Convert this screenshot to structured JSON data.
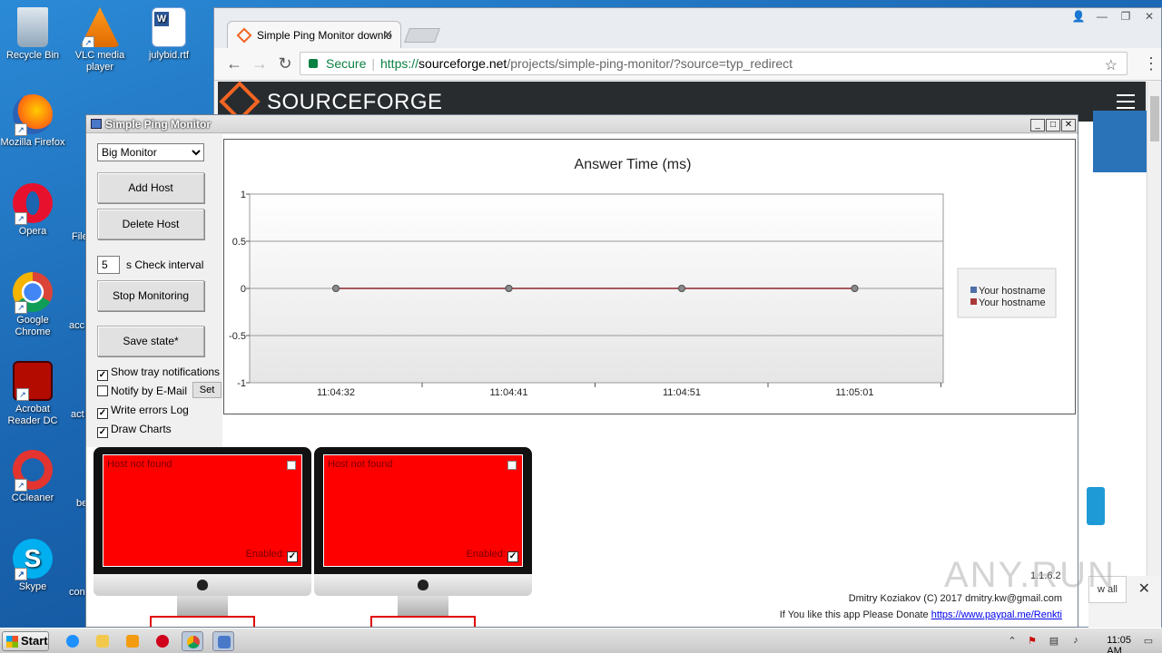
{
  "desktop": {
    "icons": [
      {
        "label": "Recycle Bin",
        "icon": "recycle-bin-icon"
      },
      {
        "label": "VLC media player",
        "icon": "vlc-icon"
      },
      {
        "label": "julybid.rtf",
        "icon": "word-document-icon"
      },
      {
        "label": "Mozilla Firefox",
        "icon": "firefox-icon"
      },
      {
        "label": "Opera",
        "icon": "opera-icon"
      },
      {
        "label": "Google Chrome",
        "icon": "chrome-icon"
      },
      {
        "label": "Acrobat Reader DC",
        "icon": "acrobat-icon"
      },
      {
        "label": "CCleaner",
        "icon": "ccleaner-icon"
      },
      {
        "label": "Skype",
        "icon": "skype-icon"
      }
    ],
    "partial_labels": [
      "File",
      "acc",
      "act",
      "be",
      "con"
    ]
  },
  "browser": {
    "tab_title": "Simple Ping Monitor downlo",
    "secure_label": "Secure",
    "url_scheme": "https://",
    "url_host": "sourceforge.net",
    "url_path": "/projects/simple-ping-monitor/?source=typ_redirect",
    "site_name": "SOURCEFORGE",
    "download_bar_button": "w all"
  },
  "ping_monitor": {
    "window_title": "Simple Ping Monitor",
    "mode_options": [
      "Big Monitor"
    ],
    "mode_selected": "Big Monitor",
    "add_host_label": "Add Host",
    "delete_host_label": "Delete Host",
    "interval_value": "5",
    "interval_label": "s Check interval",
    "stop_monitoring_label": "Stop Monitoring",
    "save_state_label": "Save state*",
    "checkboxes": [
      {
        "label": "Show tray notifications",
        "checked": true
      },
      {
        "label": "Notify by E-Mail",
        "checked": false
      },
      {
        "label": "Write errors Log",
        "checked": true
      },
      {
        "label": "Draw Charts",
        "checked": true
      }
    ],
    "set_button_label": "Set",
    "monitors": [
      {
        "status": "Host not found",
        "enabled_label": "Enabled:",
        "enabled": true,
        "color": "#ff0000"
      },
      {
        "status": "Host not found",
        "enabled_label": "Enabled:",
        "enabled": true,
        "color": "#ff0000"
      }
    ],
    "version": "1.1.6.2",
    "author": "Dmitry Koziakov (C) 2017 dmitry.kw@gmail.com",
    "donate_text": "If You like this app Please Donate",
    "donate_link": "https://www.paypal.me/Renkti"
  },
  "chart_data": {
    "type": "line",
    "title": "Answer Time (ms)",
    "x": [
      "11:04:32",
      "11:04:41",
      "11:04:51",
      "11:05:01"
    ],
    "series": [
      {
        "name": "Your hostname",
        "values": [
          0,
          0,
          0,
          0
        ],
        "color": "#4f6fa8"
      },
      {
        "name": "Your hostname",
        "values": [
          0,
          0,
          0,
          0
        ],
        "color": "#a83a3a"
      }
    ],
    "ylim": [
      -1,
      1
    ],
    "yticks": [
      "1",
      "0.5",
      "0",
      "-0.5",
      "-1"
    ],
    "legend": "right",
    "grid": true
  },
  "watermark": "ANY.RUN",
  "taskbar": {
    "start_label": "Start",
    "clock": "11:05 AM"
  }
}
